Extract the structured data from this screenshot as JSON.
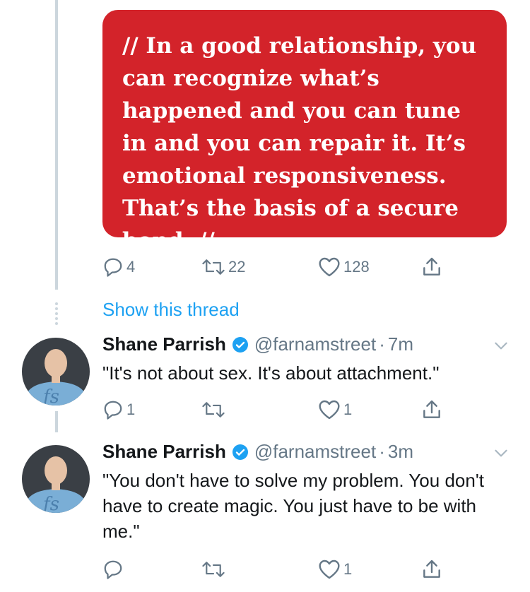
{
  "quote_card": {
    "text": "// In a good relationship, you can recognize what’s happened and you can tune in and you can repair it. It’s emotional responsiveness. That’s the basis of a secure bond. //",
    "color": "#d3232a"
  },
  "first_tweet_actions": {
    "replies": "4",
    "retweets": "22",
    "likes": "128"
  },
  "show_thread_label": "Show this thread",
  "tweets": [
    {
      "name": "Shane Parrish",
      "handle": "@farnamstreet",
      "separator": "·",
      "time": "7m",
      "text": "\"It's not about sex. It's about attachment.\"",
      "replies": "1",
      "retweets": "",
      "likes": "1"
    },
    {
      "name": "Shane Parrish",
      "handle": "@farnamstreet",
      "separator": "·",
      "time": "3m",
      "text": "\"You don't have to solve my problem. You don't have to create magic. You just have to be with me.\"",
      "replies": "",
      "retweets": "",
      "likes": "1"
    }
  ],
  "colors": {
    "link": "#1da1f2",
    "muted": "#657786",
    "thread_line": "#ccd6dd",
    "verified": "#1da1f2"
  }
}
